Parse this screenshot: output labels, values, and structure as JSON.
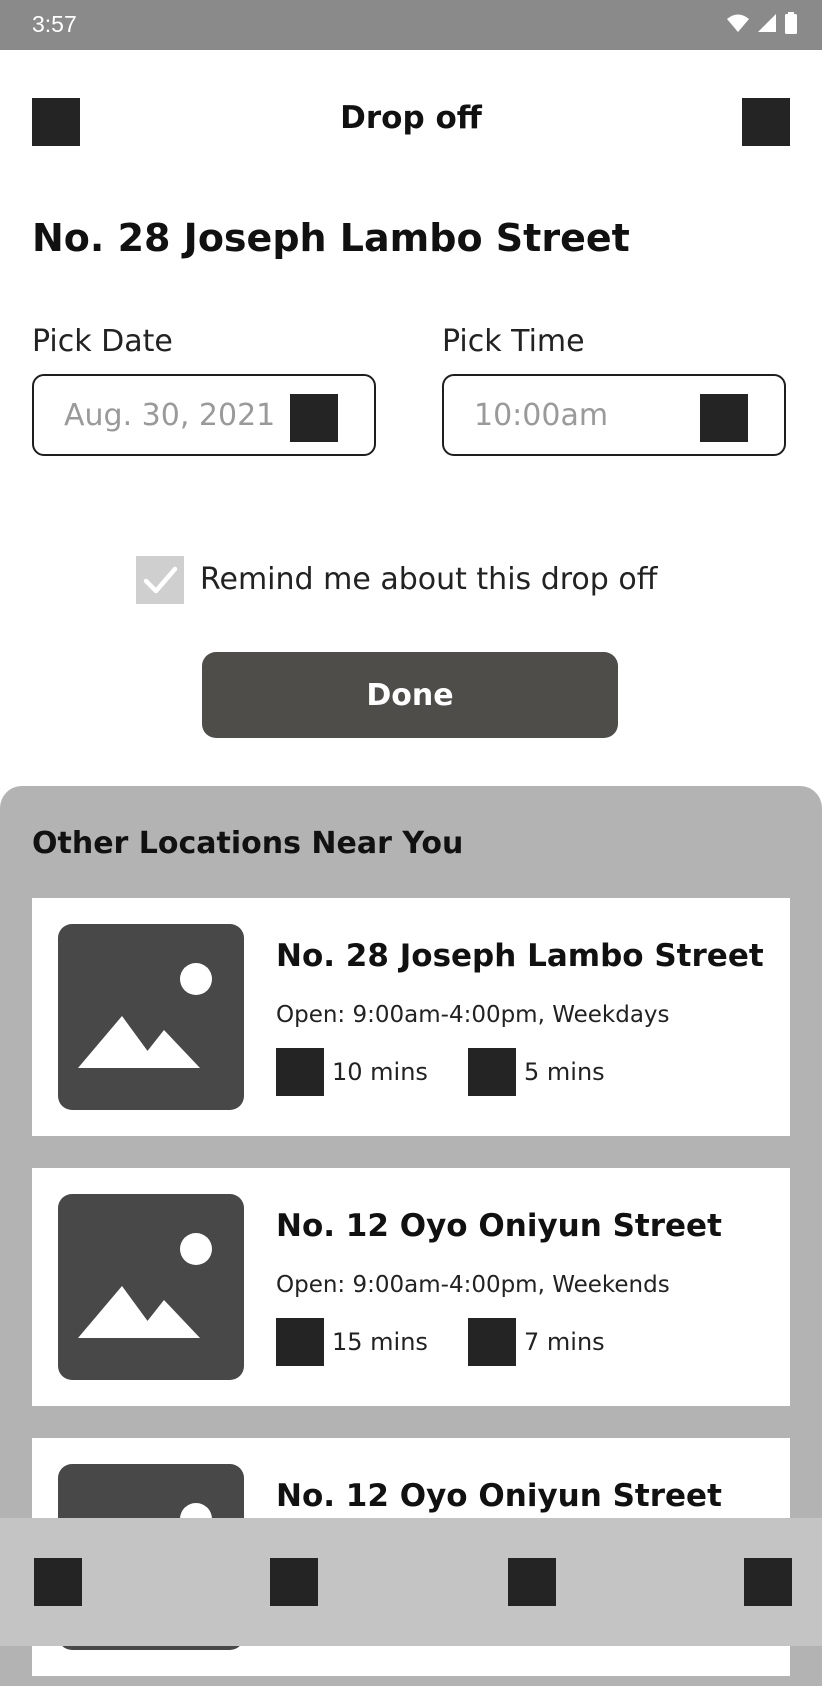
{
  "status_bar": {
    "time": "3:57",
    "icons": [
      "wifi-icon",
      "signal-icon",
      "battery-icon"
    ]
  },
  "header": {
    "title": "Drop off",
    "left_icon": "back-icon",
    "right_icon": "menu-icon"
  },
  "main": {
    "address": "No. 28 Joseph Lambo Street",
    "date_label": "Pick Date",
    "date_value": "Aug. 30, 2021",
    "time_label": "Pick Time",
    "time_value": "10:00am",
    "reminder": {
      "label": "Remind me about this drop off",
      "checked": true
    },
    "done_label": "Done"
  },
  "nearby": {
    "title": "Other Locations Near You",
    "locations": [
      {
        "name": "No. 28 Joseph Lambo Street",
        "hours": "Open: 9:00am-4:00pm, Weekdays",
        "meta1": "10 mins",
        "meta2": "5 mins"
      },
      {
        "name": "No. 12 Oyo Oniyun Street",
        "hours": "Open: 9:00am-4:00pm, Weekends",
        "meta1": "15 mins",
        "meta2": "7 mins"
      },
      {
        "name": "No. 12 Oyo Oniyun Street"
      }
    ]
  },
  "colors": {
    "status_bar": "#8a8a8a",
    "button": "#4f4d4a",
    "sheet": "#b3b3b3",
    "nav": "#c4c4c4",
    "icon": "#242424"
  }
}
